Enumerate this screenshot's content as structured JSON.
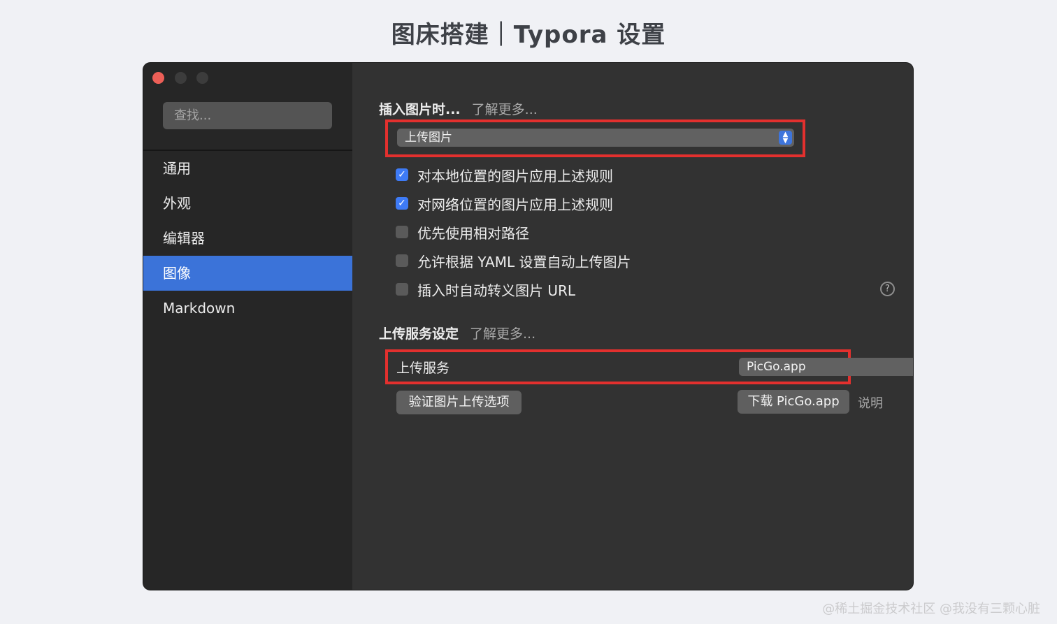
{
  "page": {
    "title": "图床搭建｜Typora 设置"
  },
  "sidebar": {
    "search_placeholder": "查找...",
    "items": [
      {
        "label": "通用",
        "active": false
      },
      {
        "label": "外观",
        "active": false
      },
      {
        "label": "编辑器",
        "active": false
      },
      {
        "label": "图像",
        "active": true
      },
      {
        "label": "Markdown",
        "active": false
      }
    ]
  },
  "insert_section": {
    "title": "插入图片时...",
    "learn_more": "了解更多...",
    "select_value": "上传图片",
    "options": [
      {
        "label": "对本地位置的图片应用上述规则",
        "checked": true
      },
      {
        "label": "对网络位置的图片应用上述规则",
        "checked": true
      },
      {
        "label": "优先使用相对路径",
        "checked": false
      },
      {
        "label": "允许根据 YAML 设置自动上传图片",
        "checked": false
      },
      {
        "label": "插入时自动转义图片 URL",
        "checked": false
      }
    ]
  },
  "upload_section": {
    "title": "上传服务设定",
    "learn_more": "了解更多...",
    "service_label": "上传服务",
    "service_value": "PicGo.app",
    "verify_button": "验证图片上传选项",
    "download_button": "下载 PicGo.app",
    "help_link": "说明"
  },
  "watermark": "@稀土掘金技术社区 @我没有三颗心脏",
  "colors": {
    "accent": "#3b73d9",
    "highlight": "#e3302e",
    "checkbox": "#3e7bf6"
  }
}
